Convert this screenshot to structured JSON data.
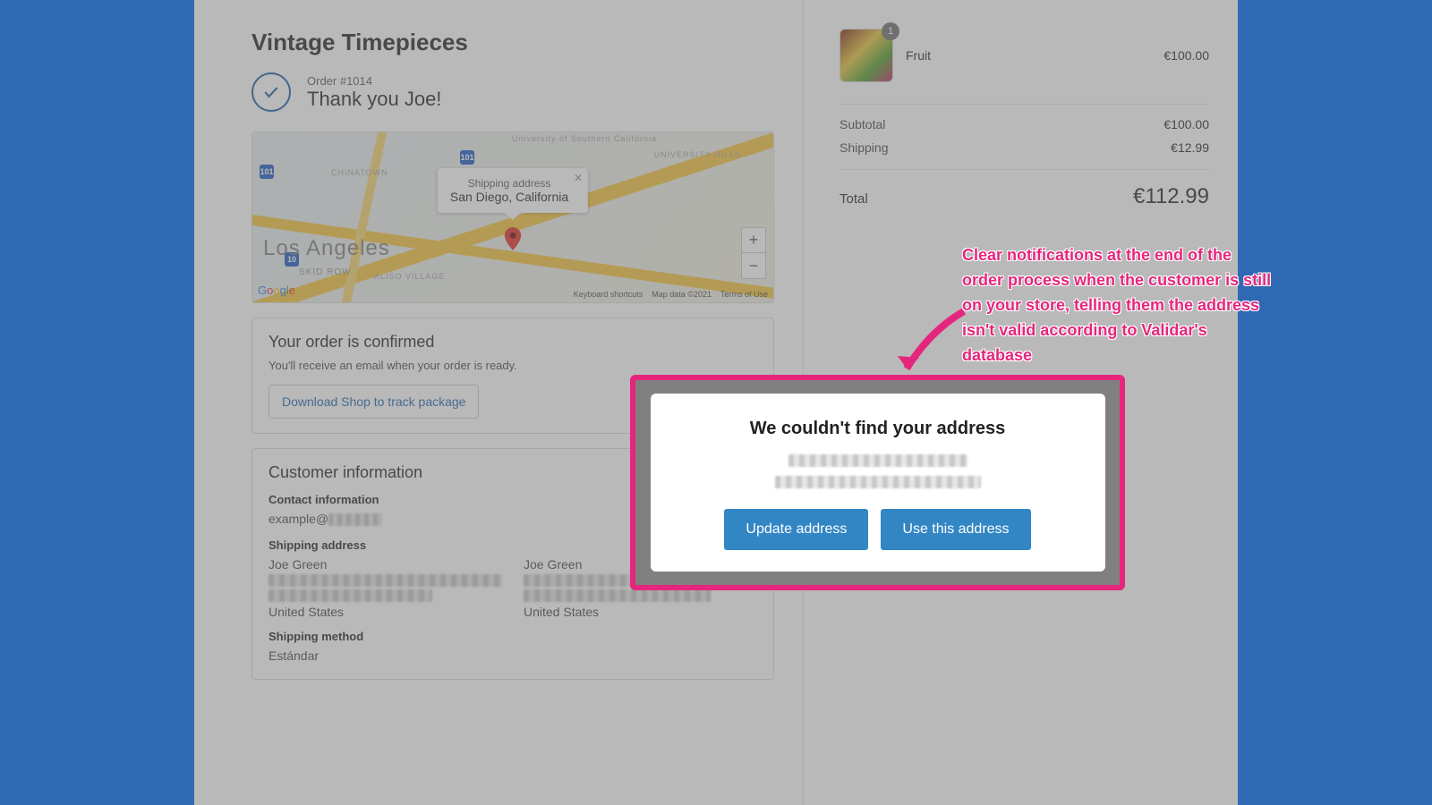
{
  "store_name": "Vintage Timepieces",
  "order_number": "Order #1014",
  "thank_you": "Thank you Joe!",
  "map": {
    "popup_label": "Shipping address",
    "popup_location": "San Diego, California",
    "big_city": "Los Angeles",
    "district": "SKID ROW",
    "hw1": "101",
    "hw2": "10",
    "attrib_shortcuts": "Keyboard shortcuts",
    "attrib_data": "Map data ©2021",
    "attrib_terms": "Terms of Use"
  },
  "confirmed": {
    "heading": "Your order is confirmed",
    "sub": "You'll receive an email when your order is ready.",
    "download": "Download Shop to track package"
  },
  "customer": {
    "heading": "Customer information",
    "contact_h": "Contact information",
    "contact_v": "example@",
    "shipping_h": "Shipping address",
    "name": "Joe Green",
    "country": "United States",
    "billing_name": "Joe Green",
    "billing_country": "United States",
    "method_h": "Shipping method",
    "method_v": "Estándar"
  },
  "cart": {
    "item_name": "Fruit",
    "item_qty": "1",
    "item_price": "€100.00",
    "subtotal_l": "Subtotal",
    "subtotal_v": "€100.00",
    "shipping_l": "Shipping",
    "shipping_v": "€12.99",
    "total_l": "Total",
    "total_v": "€112.99"
  },
  "modal": {
    "title": "We couldn't find your address",
    "update": "Update address",
    "use": "Use this address"
  },
  "annotation": "Clear notifications at the end of the order process when the customer is still on your store, telling them the address isn't valid according to Validar's database"
}
